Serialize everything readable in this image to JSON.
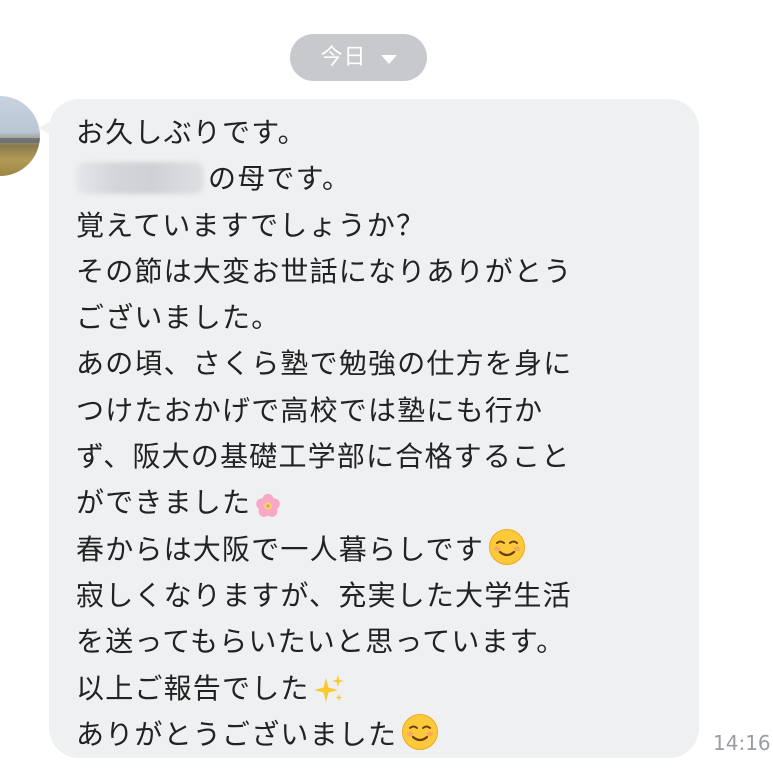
{
  "date_header": {
    "label": "今日",
    "icon": "caret-down-icon"
  },
  "message": {
    "lines": [
      "お久しぶりです。",
      "の母です。",
      "覚えていますでしょうか？",
      "その節は大変お世話になりありがとう",
      "ございました。",
      "あの頃、さくら塾で勉強の仕方を身に",
      "つけたおかげで高校では塾にも行か",
      "ず、阪大の基礎工学部に合格すること",
      "ができました",
      "春からは大阪で一人暮らしです",
      "寂しくなりますが、充実した大学生活",
      "を送ってもらいたいと思っています。",
      "以上ご報告でした",
      "ありがとうございました"
    ],
    "emoji": {
      "cherry_blossom": "cherry-blossom-icon",
      "smiling_face": "smiling-face-icon",
      "sparkles": "sparkles-icon"
    },
    "timestamp": "14:16"
  },
  "colors": {
    "bubble_bg": "#eff0f2",
    "date_pill_bg": "#c7c9cc",
    "text": "#222222",
    "timestamp": "#9a9da1"
  }
}
